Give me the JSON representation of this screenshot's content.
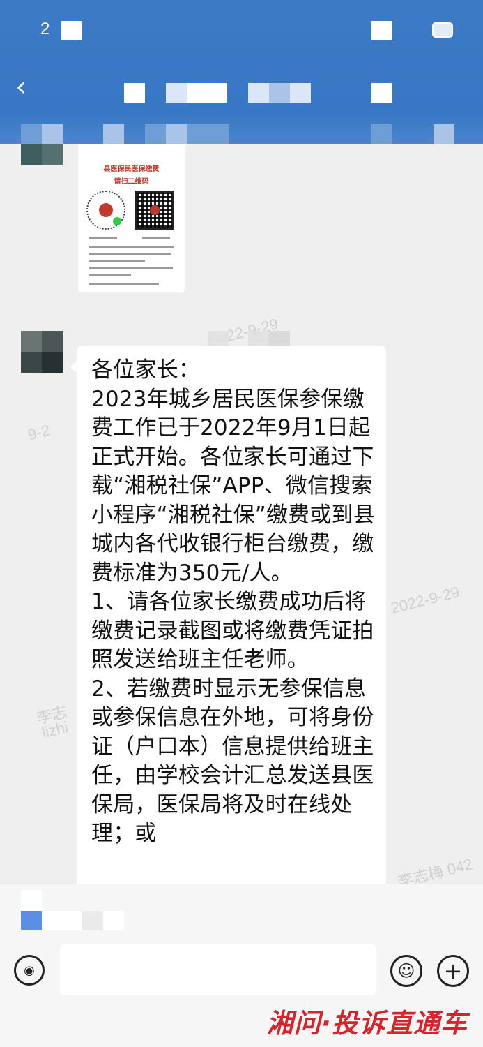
{
  "status_bar": {
    "time": "2"
  },
  "header": {
    "back_glyph": "‹",
    "title": ""
  },
  "chat": {
    "image_message": {
      "title_line1": "县医保民医保缴费",
      "title_line2": "请扫二维码"
    },
    "text_message": {
      "text": "各位家长：\n2023年城乡居民医保参保缴费工作已于2022年9月1日起正式开始。各位家长可通过下载“湘税社保”APP、微信搜索小程序“湘税社保”缴费或到县城内各代收银行柜台缴费，缴费标准为350元/人。\n1、请各位家长缴费成功后将缴费记录截图或将缴费凭证拍照发送给班主任老师。\n2、若缴费时显示无参保信息或参保信息在外地，可将身份证（户口本）信息提供给班主任，由学校会计汇总发送县医保局，医保局将及时在线处理；或"
    },
    "watermarks": [
      "2022-9-29",
      "9-2",
      "李志",
      "lizhi",
      "李志梅 042"
    ]
  },
  "input_bar": {
    "voice_icon": "voice-icon",
    "emoji_icon": "emoji-icon",
    "plus_icon": "plus-icon",
    "placeholder": ""
  },
  "brand": {
    "logo_text": "湘问·投诉直通车"
  }
}
